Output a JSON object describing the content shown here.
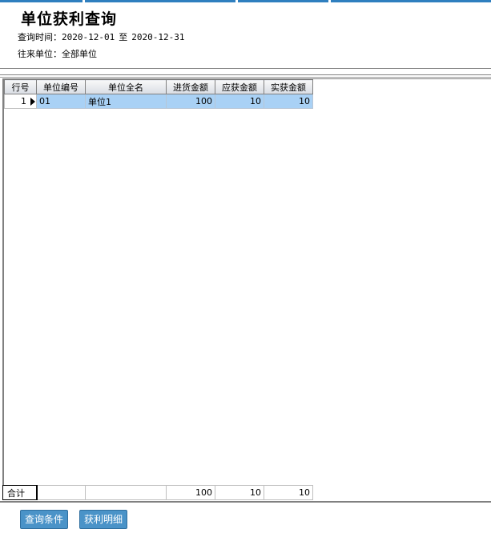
{
  "header": {
    "title": "单位获利查询",
    "query_time_label": "查询时间：",
    "date_from": "2020-12-01",
    "date_to_sep": "至",
    "date_to": "2020-12-31",
    "partner_label": "往来单位：",
    "partner_value": "全部单位"
  },
  "grid": {
    "columns": {
      "row_no": "行号",
      "unit_code": "单位编号",
      "unit_name": "单位全名",
      "purchase_amount": "进货金额",
      "receivable_amount": "应获金额",
      "actual_amount": "实获金额"
    },
    "rows": [
      {
        "row_no": "1",
        "unit_code": "01",
        "unit_name": "单位1",
        "purchase_amount": "100",
        "receivable_amount": "10",
        "actual_amount": "10"
      }
    ]
  },
  "footer": {
    "total_label": "合计",
    "purchase_total": "100",
    "receivable_total": "10",
    "actual_total": "10"
  },
  "buttons": {
    "query_conditions": "查询条件",
    "profit_detail": "获利明细"
  },
  "colors": {
    "accent": "#2f7fbf",
    "selected_row": "#a9d1f5",
    "button_bg": "#4a93c8"
  }
}
